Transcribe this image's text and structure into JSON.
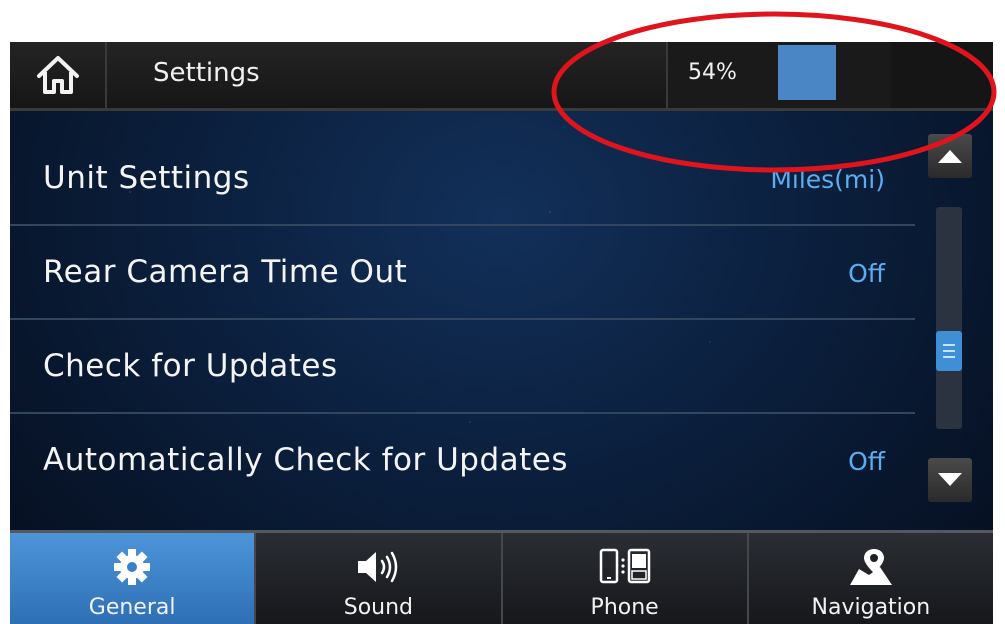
{
  "header": {
    "home_icon": "home-icon",
    "title": "Settings",
    "volume_text": "54%",
    "volume_fraction": 0.54
  },
  "settings_list": [
    {
      "label": "Unit Settings",
      "value": "Miles(mi)"
    },
    {
      "label": "Rear Camera Time Out",
      "value": "Off"
    },
    {
      "label": "Check for Updates",
      "value": ""
    },
    {
      "label": "Automatically Check for Updates",
      "value": "Off"
    }
  ],
  "scrollbar": {
    "position_fraction": 0.68
  },
  "bottom_nav": {
    "items": [
      {
        "label": "General",
        "icon": "gear-icon",
        "active": true
      },
      {
        "label": "Sound",
        "icon": "speaker-icon",
        "active": false
      },
      {
        "label": "Phone",
        "icon": "phone-icon",
        "active": false
      },
      {
        "label": "Navigation",
        "icon": "map-pin-icon",
        "active": false
      }
    ]
  },
  "colors": {
    "accent": "#4a86c6",
    "value_text": "#5aaef0",
    "annotation": "#e0141c"
  }
}
